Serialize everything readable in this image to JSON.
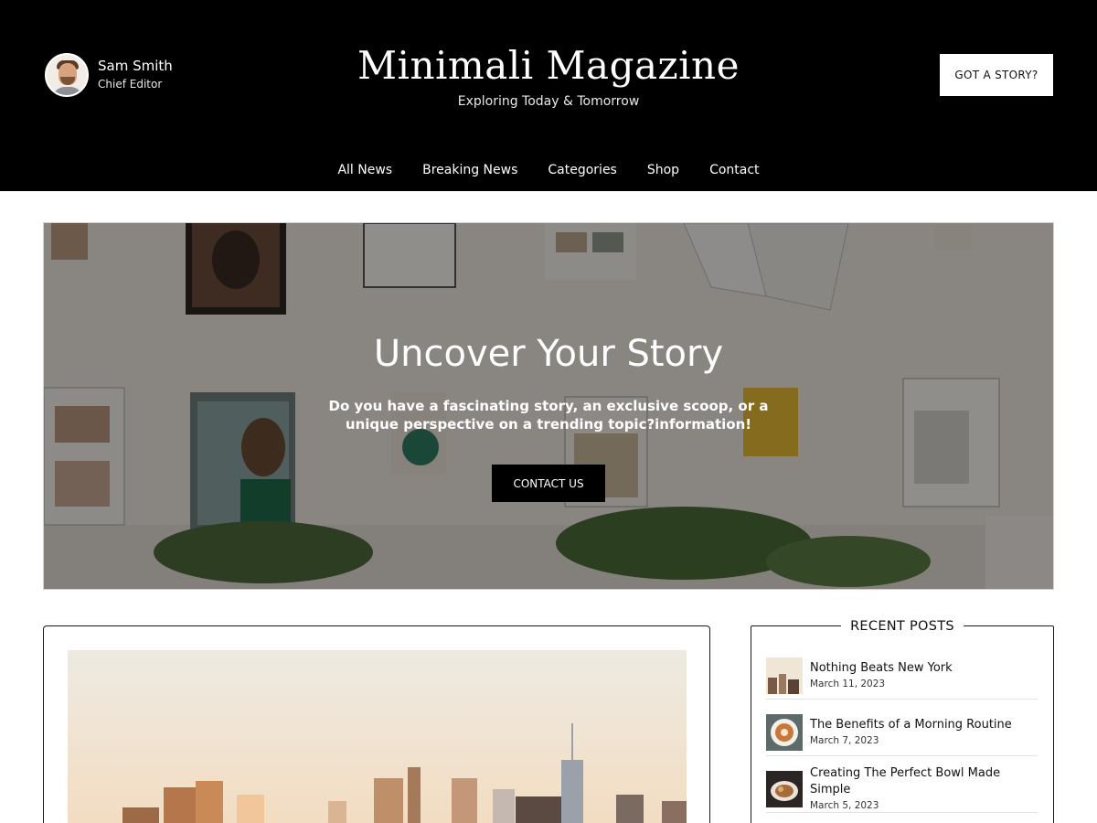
{
  "header": {
    "author_name": "Sam Smith",
    "author_role": "Chief Editor",
    "site_title": "Minimali Magazine",
    "tagline": "Exploring Today & Tomorrow",
    "cta_label": "GOT A STORY?"
  },
  "nav": {
    "items": [
      "All News",
      "Breaking News",
      "Categories",
      "Shop",
      "Contact"
    ]
  },
  "hero": {
    "title": "Uncover Your Story",
    "text": "Do you have a fascinating story, an exclusive scoop, or a unique perspective on a trending topic?information!",
    "button_label": "CONTACT US"
  },
  "sidebar": {
    "widget_title": "RECENT POSTS",
    "posts": [
      {
        "title": "Nothing Beats New York",
        "date": "March 11, 2023",
        "thumb_icon": "city-photo"
      },
      {
        "title": "The Benefits of a Morning Routine",
        "date": "March 7, 2023",
        "thumb_icon": "coffee-photo"
      },
      {
        "title": "Creating The Perfect Bowl Made Simple",
        "date": "March 5, 2023",
        "thumb_icon": "bowl-photo"
      }
    ]
  },
  "colors": {
    "header_bg": "#000000",
    "accent": "#000000",
    "page_bg": "#ffffff"
  }
}
